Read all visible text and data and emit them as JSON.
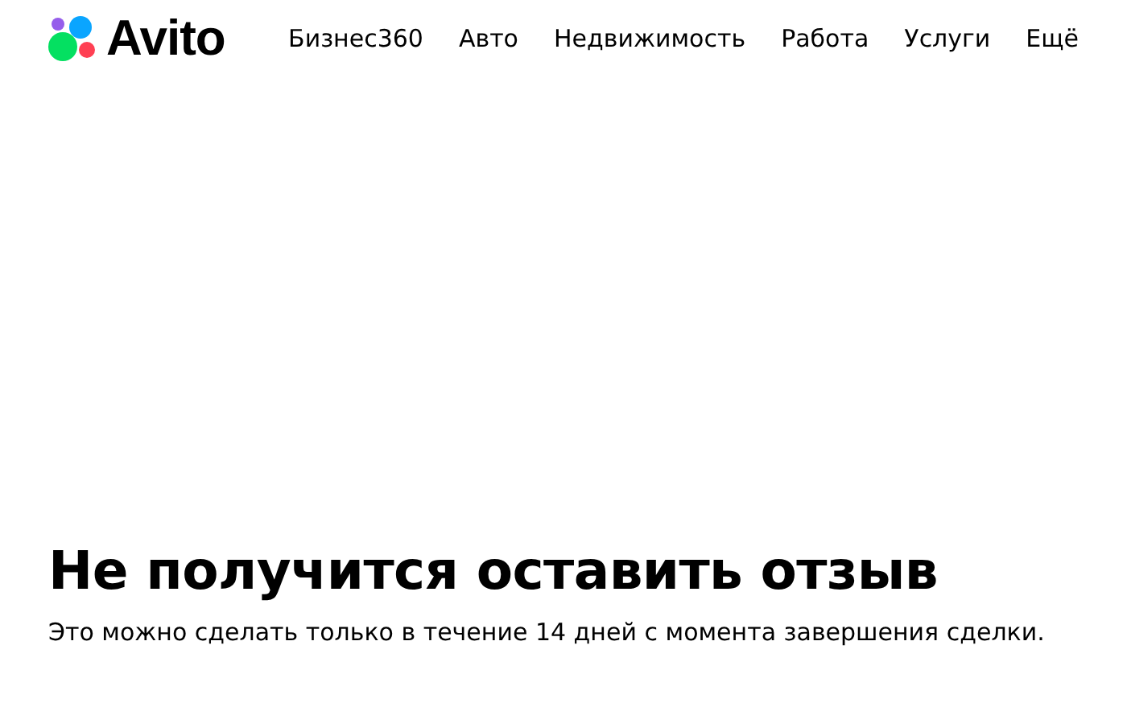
{
  "header": {
    "logo": "Avito",
    "nav": [
      "Бизнес360",
      "Авто",
      "Недвижимость",
      "Работа",
      "Услуги",
      "Ещё"
    ]
  },
  "message": {
    "title": "Не получится оставить отзыв",
    "text": "Это можно сделать только в течение 14 дней с момента завершения сделки."
  }
}
